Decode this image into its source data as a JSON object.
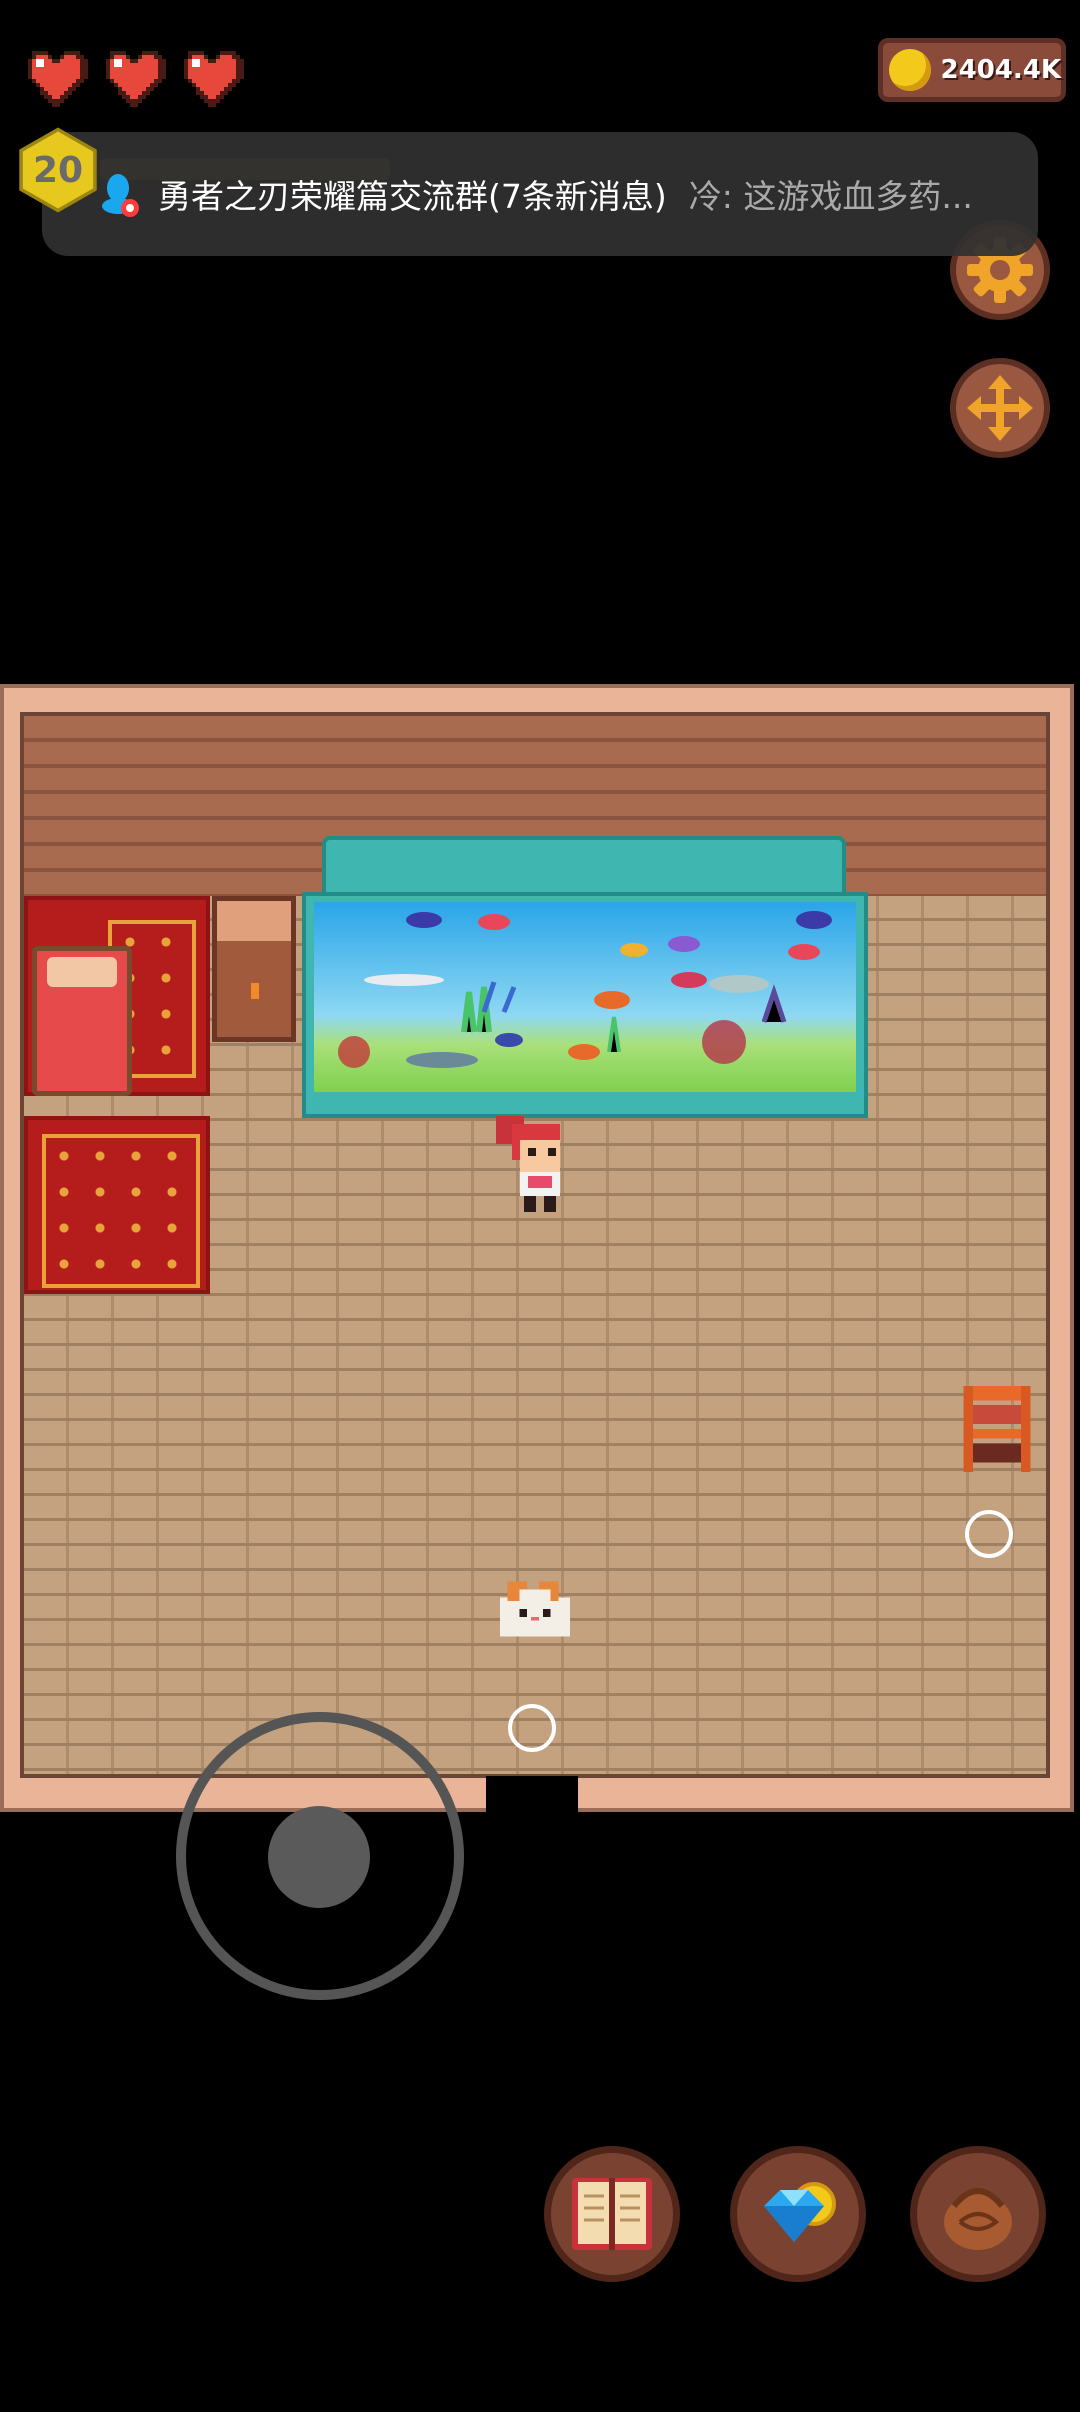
{
  "hud": {
    "hearts": [
      "heart-full",
      "heart-full",
      "heart-full"
    ],
    "coins": "2404.4K",
    "level": "20"
  },
  "notification": {
    "title": "勇者之刃荣耀篇交流群(7条新消息)",
    "message": "冷: 这游戏血多药..."
  },
  "buttons": {
    "settings": "gear-icon",
    "move": "move-arrows-icon",
    "journal": "book-icon",
    "shop": "diamond-coin-icon",
    "inventory": "bag-icon"
  },
  "colors": {
    "heart": "#e8473b",
    "coin": "#f3c91b",
    "gear": "#f0a52a",
    "rug": "#b51d1d",
    "wall": "#a86b4f",
    "floor": "#c4a27f",
    "aquarium": "#3fb6b0"
  }
}
